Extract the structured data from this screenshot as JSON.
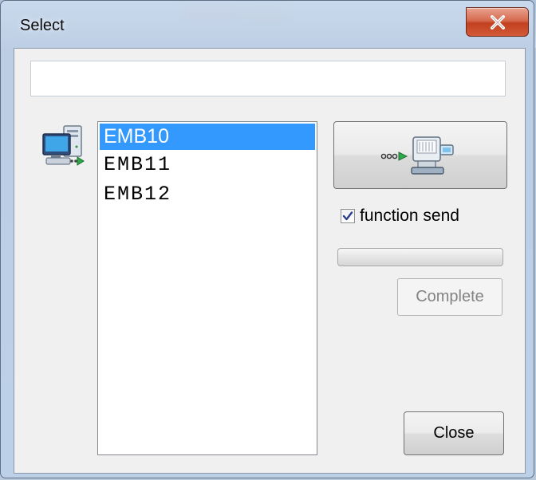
{
  "window": {
    "title": "Select"
  },
  "text_field": {
    "value": ""
  },
  "list": {
    "items": [
      {
        "label": "EMB10",
        "selected": true
      },
      {
        "label": "EMB11",
        "selected": false
      },
      {
        "label": "EMB12",
        "selected": false
      }
    ]
  },
  "send": {
    "icon": "send-to-embroidery-machine-icon"
  },
  "function_send": {
    "label": "function send",
    "checked": true
  },
  "progress": {
    "value": 0
  },
  "buttons": {
    "complete_label": "Complete",
    "close_label": "Close"
  },
  "colors": {
    "selection": "#3399ff",
    "close_button": "#c1401f"
  }
}
